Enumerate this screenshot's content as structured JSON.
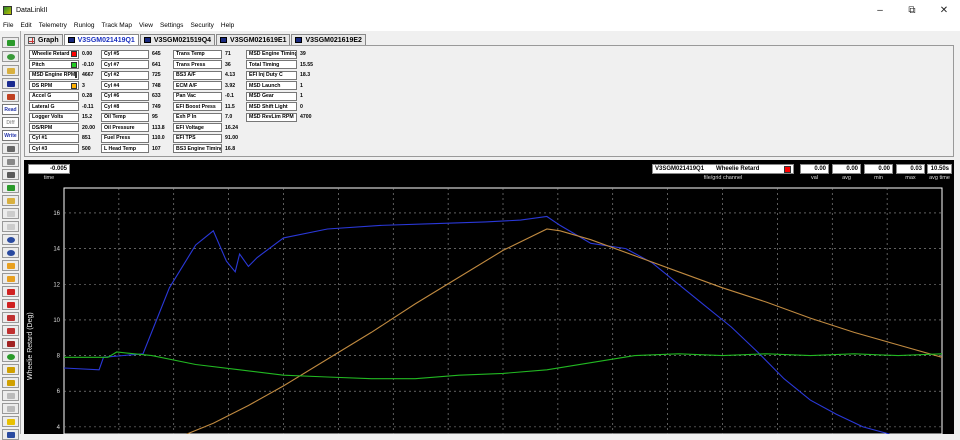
{
  "window": {
    "title": "DataLinkII"
  },
  "menu": [
    "File",
    "Edit",
    "Telemetry",
    "Runlog",
    "Track Map",
    "View",
    "Settings",
    "Security",
    "Help"
  ],
  "toolbar_texts": {
    "read": "Read",
    "diff": "Diff",
    "write": "Write"
  },
  "tabs": [
    {
      "label": "Graph",
      "icon": "graph-icon",
      "active": false
    },
    {
      "label": "V3SGM021419Q1",
      "icon": "disk-icon",
      "active": true
    },
    {
      "label": "V3SGM021519Q4",
      "icon": "disk-icon",
      "active": false
    },
    {
      "label": "V3SGM021619E1",
      "icon": "disk-icon",
      "active": false
    },
    {
      "label": "V3SGM021619E2",
      "icon": "disk-icon",
      "active": false
    }
  ],
  "params": {
    "col1": [
      {
        "name": "Wheelie Retard",
        "value": "0.00",
        "color": "#ff0000"
      },
      {
        "name": "Pitch",
        "value": "-0.10",
        "color": "#22cc22"
      },
      {
        "name": "MSD Engine RPM",
        "value": "4667",
        "color": "#1010ff"
      },
      {
        "name": "DS RPM",
        "value": "3",
        "color": "#ffb000"
      },
      {
        "name": "Accel G",
        "value": "0.28"
      },
      {
        "name": "Lateral G",
        "value": "-0.11"
      },
      {
        "name": "Logger Volts",
        "value": "15.2"
      },
      {
        "name": "DS/RPM",
        "value": "20.00"
      },
      {
        "name": "Cyl #1",
        "value": "851"
      },
      {
        "name": "Cyl #3",
        "value": "500"
      }
    ],
    "col2": [
      {
        "name": "Cyl #5",
        "value": "645"
      },
      {
        "name": "Cyl #7",
        "value": "641"
      },
      {
        "name": "Cyl #2",
        "value": "725"
      },
      {
        "name": "Cyl #4",
        "value": "748"
      },
      {
        "name": "Cyl #6",
        "value": "633"
      },
      {
        "name": "Cyl #8",
        "value": "749"
      },
      {
        "name": "Oil Temp",
        "value": "95"
      },
      {
        "name": "Oil Pressure",
        "value": "113.8"
      },
      {
        "name": "Fuel Press",
        "value": "110.0"
      },
      {
        "name": "L Head Temp",
        "value": "107"
      }
    ],
    "col3": [
      {
        "name": "Trans Temp",
        "value": "71"
      },
      {
        "name": "Trans Press",
        "value": "36"
      },
      {
        "name": "BS3 A/F",
        "value": "4.13"
      },
      {
        "name": "ECM A/F",
        "value": "3.92"
      },
      {
        "name": "Pan Vac",
        "value": "-0.1"
      },
      {
        "name": "EFI Boost Press",
        "value": "11.5"
      },
      {
        "name": "Exh P In",
        "value": "7.0"
      },
      {
        "name": "EFI Voltage",
        "value": "16.24"
      },
      {
        "name": "EFI TPS",
        "value": "91.00"
      },
      {
        "name": "BS3 Engine Timing",
        "value": "16.8"
      }
    ],
    "col4": [
      {
        "name": "MSD Engine Timing",
        "value": "39"
      },
      {
        "name": "Total Timing",
        "value": "15.55"
      },
      {
        "name": "EFI Inj Duty C",
        "value": "18.3"
      },
      {
        "name": "MSD Launch",
        "value": "1"
      },
      {
        "name": "MSD Gear",
        "value": "1"
      },
      {
        "name": "MSD Shift Light",
        "value": "0"
      },
      {
        "name": "MSD RevLim RPM",
        "value": "4700"
      }
    ]
  },
  "plot_header": {
    "time_value": "-0.005",
    "time_label": "time",
    "file_name": "V3SGM021419Q1",
    "channel_name": "Wheelie Retard",
    "channel_label": "file/grid channel",
    "val": "0.00",
    "val_label": "val",
    "avg": "0.00",
    "avg_label": "avg",
    "min": "0.00",
    "min_label": "min",
    "max": "0.03",
    "max_label": "max",
    "avg_time": "10.50s",
    "avg_time_label": "avg time"
  },
  "chart_data": {
    "type": "line",
    "ylabel": "Wheelie Retard (Deg)",
    "yticks": [
      4,
      6,
      8,
      10,
      12,
      14,
      16
    ],
    "ylim": [
      3.6,
      17.4
    ],
    "xlim": [
      0,
      1
    ],
    "grid": true,
    "series": [
      {
        "color": "#2a38d8",
        "points": [
          [
            0,
            7.3
          ],
          [
            0.04,
            7.2
          ],
          [
            0.045,
            7.9
          ],
          [
            0.09,
            8.1
          ],
          [
            0.12,
            11.8
          ],
          [
            0.15,
            14.2
          ],
          [
            0.17,
            15.0
          ],
          [
            0.185,
            13.3
          ],
          [
            0.195,
            12.7
          ],
          [
            0.2,
            13.7
          ],
          [
            0.21,
            13.0
          ],
          [
            0.22,
            13.5
          ],
          [
            0.25,
            14.6
          ],
          [
            0.3,
            15.1
          ],
          [
            0.36,
            15.3
          ],
          [
            0.42,
            15.4
          ],
          [
            0.48,
            15.5
          ],
          [
            0.52,
            15.6
          ],
          [
            0.55,
            15.8
          ],
          [
            0.565,
            15.3
          ],
          [
            0.6,
            14.3
          ],
          [
            0.64,
            14.0
          ],
          [
            0.67,
            13.2
          ],
          [
            0.7,
            12.0
          ],
          [
            0.73,
            10.8
          ],
          [
            0.76,
            9.6
          ],
          [
            0.79,
            8.2
          ],
          [
            0.82,
            6.7
          ],
          [
            0.85,
            5.5
          ],
          [
            0.88,
            4.7
          ],
          [
            0.91,
            4.0
          ],
          [
            0.94,
            3.6
          ]
        ]
      },
      {
        "color": "#c08a40",
        "points": [
          [
            0.14,
            3.6
          ],
          [
            0.17,
            4.2
          ],
          [
            0.21,
            5.2
          ],
          [
            0.25,
            6.3
          ],
          [
            0.3,
            7.8
          ],
          [
            0.35,
            9.3
          ],
          [
            0.4,
            10.9
          ],
          [
            0.45,
            12.4
          ],
          [
            0.5,
            13.9
          ],
          [
            0.55,
            15.1
          ],
          [
            0.565,
            15.0
          ],
          [
            0.6,
            14.5
          ],
          [
            0.65,
            13.6
          ],
          [
            0.7,
            12.7
          ],
          [
            0.75,
            11.8
          ],
          [
            0.8,
            11.0
          ],
          [
            0.85,
            10.1
          ],
          [
            0.9,
            9.3
          ],
          [
            0.95,
            8.6
          ],
          [
            1.0,
            7.9
          ]
        ]
      },
      {
        "color": "#22b822",
        "points": [
          [
            0,
            7.9
          ],
          [
            0.05,
            7.9
          ],
          [
            0.06,
            8.2
          ],
          [
            0.1,
            8.0
          ],
          [
            0.15,
            7.5
          ],
          [
            0.2,
            7.2
          ],
          [
            0.25,
            6.9
          ],
          [
            0.3,
            6.8
          ],
          [
            0.35,
            6.7
          ],
          [
            0.4,
            6.7
          ],
          [
            0.45,
            6.9
          ],
          [
            0.5,
            7.0
          ],
          [
            0.55,
            7.2
          ],
          [
            0.6,
            7.6
          ],
          [
            0.65,
            8.0
          ],
          [
            0.7,
            8.1
          ],
          [
            0.75,
            8.0
          ],
          [
            0.8,
            8.1
          ],
          [
            0.85,
            8.0
          ],
          [
            0.9,
            8.1
          ],
          [
            0.95,
            8.0
          ],
          [
            1.0,
            8.1
          ]
        ]
      }
    ]
  }
}
